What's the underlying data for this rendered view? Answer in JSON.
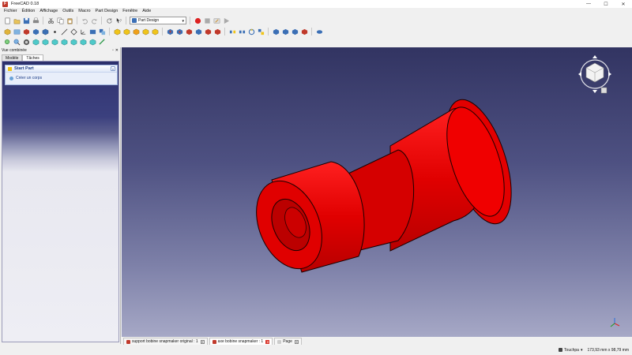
{
  "window": {
    "title": "FreeCAD 0.18",
    "logo_letter": "F",
    "minimize": "—",
    "maximize": "☐",
    "close": "✕"
  },
  "menu": [
    "Fichier",
    "Édition",
    "Affichage",
    "Outils",
    "Macro",
    "Part Design",
    "Fenêtre",
    "Aide"
  ],
  "toolbar": {
    "workbench_selected": "Part Design"
  },
  "left_panel": {
    "header_title": "Vue combinée",
    "tabs": [
      "Modèle",
      "Tâches"
    ],
    "active_tab": "Tâches",
    "task_title": "Start Part",
    "task_action": "Créer un corps",
    "collapse_glyph": "«",
    "header_float": "▫",
    "header_close": "✕"
  },
  "document_tabs": [
    {
      "label": "support bobine snapmaker original : 1",
      "active": false
    },
    {
      "label": "axe bobine snapmaker : 1",
      "active": true
    },
    {
      "label": "Page",
      "active": false
    }
  ],
  "doc_tab_close": "✕",
  "status": {
    "navigation_style": "Touchpa",
    "dimensions": "173,93 mm x 98,79 mm"
  },
  "colors": {
    "model_red": "#e00000",
    "view_bg_top": "#323462",
    "view_bg_bottom": "#a6a8c6"
  }
}
